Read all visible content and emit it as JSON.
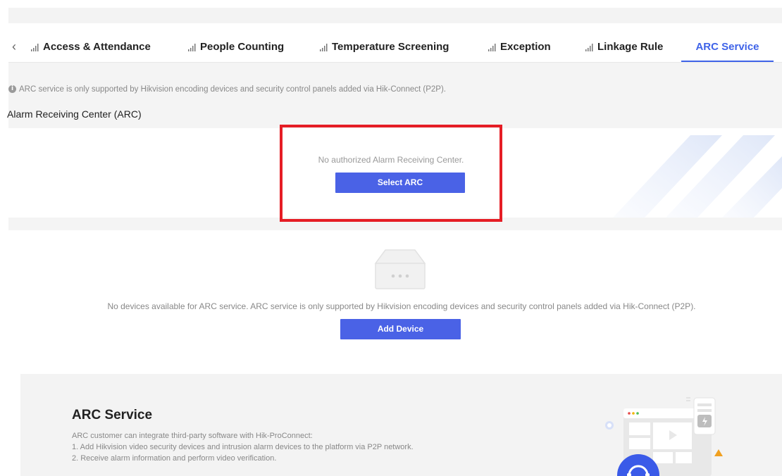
{
  "tabs": [
    {
      "label": "Access & Attendance"
    },
    {
      "label": "People Counting"
    },
    {
      "label": "Temperature Screening"
    },
    {
      "label": "Exception"
    },
    {
      "label": "Linkage Rule"
    },
    {
      "label": "ARC Service",
      "active": true
    }
  ],
  "arc": {
    "notice": "ARC service is only supported by Hikvision encoding devices and security control panels added via Hik-Connect (P2P).",
    "section_title": "Alarm Receiving Center (ARC)",
    "empty_text": "No authorized Alarm Receiving Center.",
    "select_button": "Select ARC"
  },
  "devices": {
    "empty_text": "No devices available for ARC service. ARC service is only supported by Hikvision encoding devices and security control panels added via Hik-Connect (P2P).",
    "add_button": "Add Device"
  },
  "promo": {
    "title": "ARC Service",
    "lines": [
      "ARC customer can integrate third-party software with Hik-ProConnect:",
      "1. Add Hikvision video security devices and intrusion alarm devices to the platform via P2P network.",
      "2. Receive alarm information and perform video verification."
    ]
  },
  "colors": {
    "accent": "#3f63e8",
    "button": "#4a62e6",
    "highlight_box": "#e51d25"
  },
  "icons": [
    "chevron-left-icon",
    "signal-icon",
    "info-icon",
    "device-box-icon",
    "headset-icon"
  ]
}
